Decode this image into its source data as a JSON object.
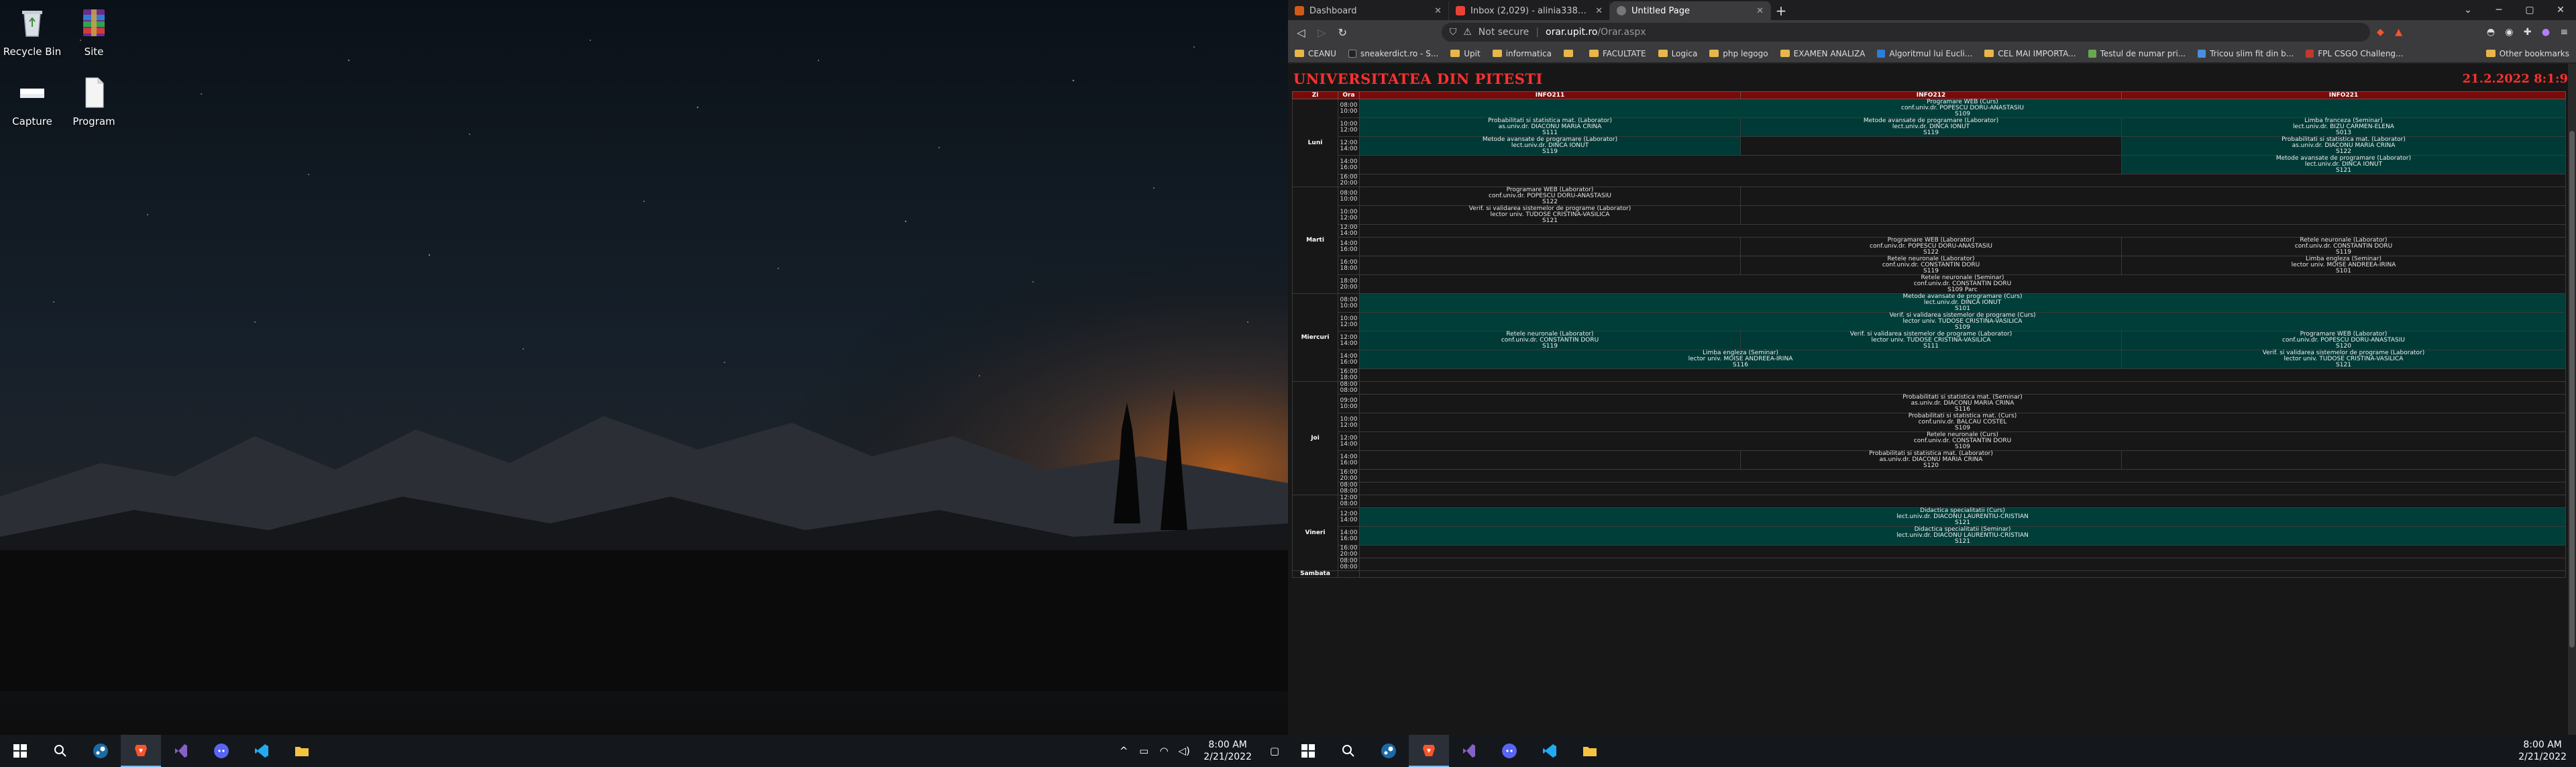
{
  "desktop_left": {
    "icons": [
      {
        "name": "recycle-bin",
        "label": "Recycle Bin"
      },
      {
        "name": "site",
        "label": "Site"
      },
      {
        "name": "capture",
        "label": "Capture"
      },
      {
        "name": "program",
        "label": "Program"
      }
    ],
    "clock": {
      "time": "8:00 AM",
      "date": "2/21/2022"
    }
  },
  "desktop_right": {
    "clock": {
      "time": "8:00 AM",
      "date": "2/21/2022"
    }
  },
  "browser": {
    "tabs": [
      {
        "label": "Dashboard",
        "active": false
      },
      {
        "label": "Inbox (2,029) - alinia338@gmail.com",
        "active": false
      },
      {
        "label": "Untitled Page",
        "active": true
      }
    ],
    "url": {
      "security": "Not secure",
      "host": "orar.upit.ro",
      "path": "/Orar.aspx"
    },
    "bookmarks": [
      {
        "label": "CEANU",
        "type": "folder"
      },
      {
        "label": "sneakerdict.ro - S...",
        "type": "site"
      },
      {
        "label": "Upit",
        "type": "folder"
      },
      {
        "label": "informatica",
        "type": "folder"
      },
      {
        "label": "",
        "type": "folder"
      },
      {
        "label": "FACULTATE",
        "type": "folder"
      },
      {
        "label": "Logica",
        "type": "folder"
      },
      {
        "label": "php legogo",
        "type": "folder"
      },
      {
        "label": "EXAMEN ANALIZA",
        "type": "folder"
      },
      {
        "label": "Algoritmul lui Eucli...",
        "type": "site"
      },
      {
        "label": "CEL MAI IMPORTA...",
        "type": "folder"
      },
      {
        "label": "Testul de numar pri...",
        "type": "site"
      },
      {
        "label": "Tricou slim fit din b...",
        "type": "site"
      },
      {
        "label": "FPL CSGO Challeng...",
        "type": "site"
      }
    ],
    "other_bookmarks": "Other bookmarks"
  },
  "page": {
    "title": "UNIVERSITATEA DIN PITESTI",
    "date": "21.2.2022 8:1:9",
    "headers": {
      "zi": "Zi",
      "ora": "Ora",
      "g1": "INFO211",
      "g2": "INFO212",
      "g3": "INFO221"
    },
    "days": {
      "luni": "Luni",
      "marti": "Marti",
      "miercuri": "Miercuri",
      "joi": "Joi",
      "vineri": "Vineri",
      "sambata": "Sambata"
    },
    "hours": {
      "h08": "08:00\n10:00",
      "h10": "10:00\n12:00",
      "h12": "12:00\n14:00",
      "h14": "14:00\n16:00",
      "h16": "16:00\n18:00",
      "h18": "18:00\n20:00",
      "h1620": "16:00\n20:00",
      "h0808": "08:00\n08:00",
      "h0809": "08:00\n09:00",
      "h0910": "09:00\n10:00",
      "h1416": "14:00\n16:00",
      "h1620b": "16:00\n20:00",
      "h1208": "12:00\n08:00"
    },
    "events": {
      "l1": "Programare WEB (Curs)\nconf.univ.dr. POPESCU DORU-ANASTASIU\nS109",
      "l2a": "Probabilitati si statistica mat. (Laborator)\nas.univ.dr. DIACONU MARIA CRINA\nS111",
      "l2b": "Metode avansate de programare (Laborator)\nlect.univ.dr. DINCA IONUT\nS119",
      "l2c": "Limba franceza (Seminar)\nlect.univ.dr. BIZU CARMEN-ELENA\nS013",
      "l3a": "Metode avansate de programare (Laborator)\nlect.univ.dr. DINCA IONUT\nS119",
      "l3c": "Probabilitati si statistica mat. (Laborator)\nas.univ.dr. DIACONU MARIA CRINA\nS122",
      "l4c": "Metode avansate de programare (Laborator)\nlect.univ.dr. DINCA IONUT\nS121",
      "m1a": "Programare WEB (Laborator)\nconf.univ.dr. POPESCU DORU-ANASTASIU\nS122",
      "m2a": "Verif. si validarea sistemelor de programe (Laborator)\nlector univ. TUDOSE CRISTINA-VASILICA\nS121",
      "m3b": "Programare WEB (Laborator)\nconf.univ.dr. POPESCU DORU-ANASTASIU\nS122",
      "m3c": "Retele neuronale (Laborator)\nconf.univ.dr. CONSTANTIN DORU\nS119",
      "m4b": "Retele neuronale (Laborator)\nconf.univ.dr. CONSTANTIN DORU\nS119",
      "m4c": "Limba engleza (Seminar)\nlector univ. MOISE ANDREEA-IRINA\nS101",
      "m5": "Retele neuronale (Seminar)\nconf.univ.dr. CONSTANTIN DORU\nS109 Parc",
      "w1": "Metode avansate de programare (Curs)\nlect.univ.dr. DINCA IONUT\nS101",
      "w2": "Verif. si validarea sistemelor de programe (Curs)\nlector univ. TUDOSE CRISTINA-VASILICA\nS109",
      "w3a": "Retele neuronale (Laborator)\nconf.univ.dr. CONSTANTIN DORU\nS119",
      "w3b": "Verif. si validarea sistemelor de programe (Laborator)\nlector univ. TUDOSE CRISTINA-VASILICA\nS111",
      "w3c": "Programare WEB (Laborator)\nconf.univ.dr. POPESCU DORU-ANASTASIU\nS120",
      "w4ab": "Limba engleza (Seminar)\nlector univ. MOISE ANDREEA-IRINA\nS116",
      "w4c": "Verif. si validarea sistemelor de programe (Laborator)\nlector univ. TUDOSE CRISTINA-VASILICA\nS121",
      "j1": "Probabilitati si statistica mat. (Seminar)\nas.univ.dr. DIACONU MARIA CRINA\nS116",
      "j2": "Probabilitati si statistica mat. (Curs)\nconf.univ.dr. BALCAU COSTEL\nS109",
      "j3": "Retele neuronale (Curs)\nconf.univ.dr. CONSTANTIN DORU\nS109",
      "j4b": "Probabilitati si statistica mat. (Laborator)\nas.univ.dr. DIACONU MARIA CRINA\nS120",
      "v1": "Didactica specialitatii (Curs)\nlect.univ.dr. DIACONU LAURENTIU-CRISTIAN\nS121",
      "v2": "Didactica specialitatii (Seminar)\nlect.univ.dr. DIACONU LAURENTIU-CRISTIAN\nS121"
    }
  }
}
